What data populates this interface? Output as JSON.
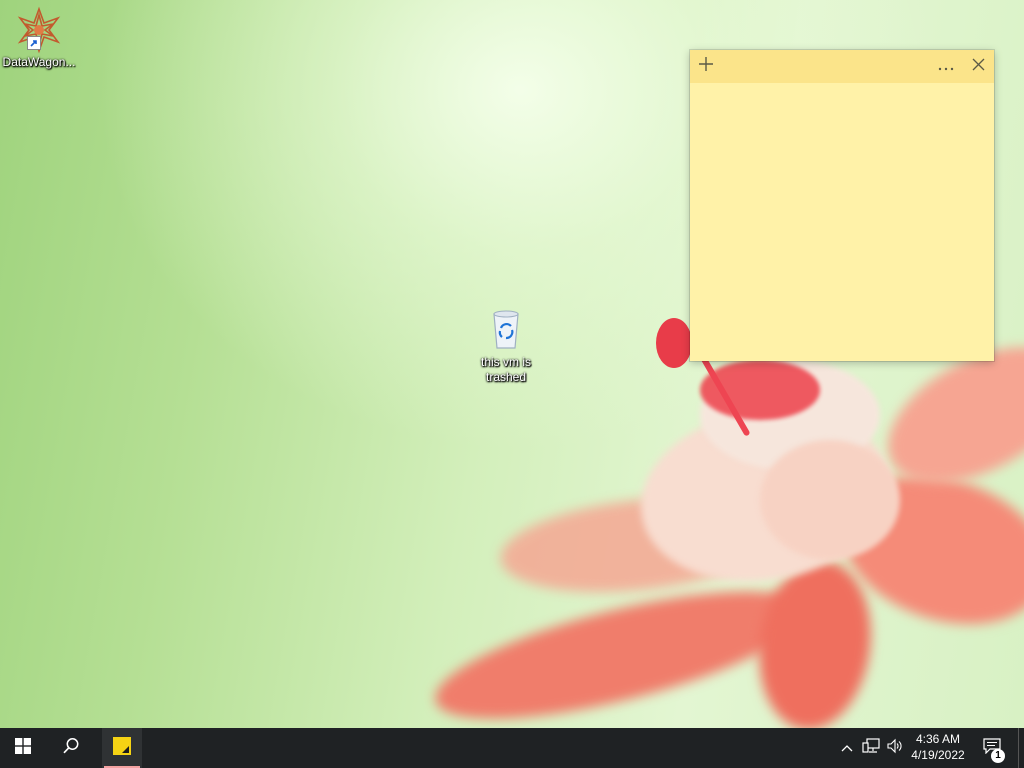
{
  "desktop": {
    "icons": [
      {
        "label": "DataWagon..."
      },
      {
        "label": "this vm is trashed"
      }
    ]
  },
  "sticky_note": {
    "content": ""
  },
  "taskbar": {
    "clock": {
      "time": "4:36 AM",
      "date": "4/19/2022"
    },
    "notifications_count": "1"
  },
  "colors": {
    "sticky_bar": "#fbe48a",
    "sticky_body": "#fff2a8",
    "taskbar": "#1f2224",
    "start_accent": "#ffffff",
    "active_indicator": "#f3a1a1"
  },
  "icons": {
    "start": "windows-logo-icon",
    "search": "magnifier-icon",
    "sticky_app": "sticky-notes-icon",
    "tray_chevron": "chevron-up-icon",
    "network": "network-icon",
    "volume": "speaker-icon",
    "action_center": "notification-icon"
  }
}
